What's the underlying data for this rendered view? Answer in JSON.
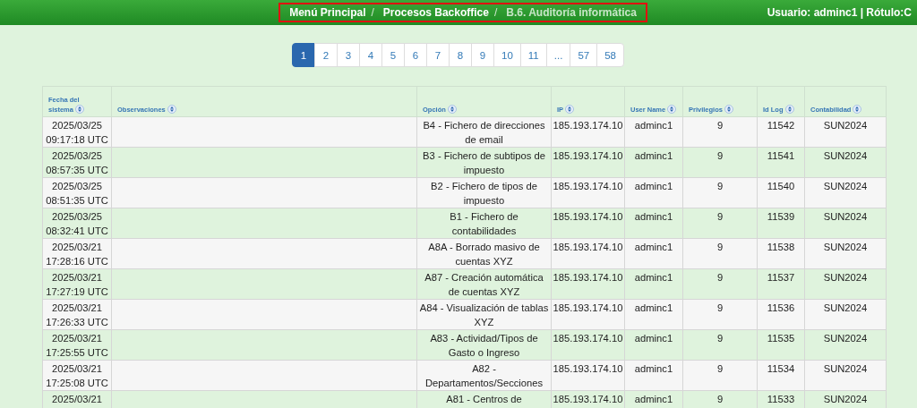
{
  "breadcrumb": [
    {
      "label": "Menú Principal",
      "current": false
    },
    {
      "label": "Procesos Backoffice",
      "current": false
    },
    {
      "label": "B.6. Auditoría informática",
      "current": true
    }
  ],
  "breadcrumb_separator": "/",
  "user_info": "Usuario: adminc1 | Rótulo:C",
  "pagination": [
    {
      "label": "1",
      "selected": true
    },
    {
      "label": "2",
      "selected": false
    },
    {
      "label": "3",
      "selected": false
    },
    {
      "label": "4",
      "selected": false
    },
    {
      "label": "5",
      "selected": false
    },
    {
      "label": "6",
      "selected": false
    },
    {
      "label": "7",
      "selected": false
    },
    {
      "label": "8",
      "selected": false
    },
    {
      "label": "9",
      "selected": false
    },
    {
      "label": "10",
      "selected": false
    },
    {
      "label": "11",
      "selected": false
    },
    {
      "label": "...",
      "selected": false
    },
    {
      "label": "57",
      "selected": false
    },
    {
      "label": "58",
      "selected": false
    }
  ],
  "table": {
    "columns": [
      {
        "label": "Fecha del sistema"
      },
      {
        "label": "Observaciones"
      },
      {
        "label": "Opción"
      },
      {
        "label": "IP"
      },
      {
        "label": "User Name"
      },
      {
        "label": "Privilegios"
      },
      {
        "label": "Id Log"
      },
      {
        "label": "Contabilidad"
      }
    ],
    "rows": [
      {
        "cells": [
          "2025/03/25 09:17:18 UTC",
          "",
          "B4 - Fichero de direcciones de email",
          "185.193.174.10",
          "adminc1",
          "9",
          "11542",
          "SUN2024"
        ]
      },
      {
        "cells": [
          "2025/03/25 08:57:35 UTC",
          "",
          "B3 - Fichero de subtipos de impuesto",
          "185.193.174.10",
          "adminc1",
          "9",
          "11541",
          "SUN2024"
        ]
      },
      {
        "cells": [
          "2025/03/25 08:51:35 UTC",
          "",
          "B2 - Fichero de tipos de impuesto",
          "185.193.174.10",
          "adminc1",
          "9",
          "11540",
          "SUN2024"
        ]
      },
      {
        "cells": [
          "2025/03/25 08:32:41 UTC",
          "",
          "B1 - Fichero de contabilidades",
          "185.193.174.10",
          "adminc1",
          "9",
          "11539",
          "SUN2024"
        ]
      },
      {
        "cells": [
          "2025/03/21 17:28:16 UTC",
          "",
          "A8A - Borrado masivo de cuentas XYZ",
          "185.193.174.10",
          "adminc1",
          "9",
          "11538",
          "SUN2024"
        ]
      },
      {
        "cells": [
          "2025/03/21 17:27:19 UTC",
          "",
          "A87 - Creación automática de cuentas XYZ",
          "185.193.174.10",
          "adminc1",
          "9",
          "11537",
          "SUN2024"
        ]
      },
      {
        "cells": [
          "2025/03/21 17:26:33 UTC",
          "",
          "A84 - Visualización de tablas XYZ",
          "185.193.174.10",
          "adminc1",
          "9",
          "11536",
          "SUN2024"
        ]
      },
      {
        "cells": [
          "2025/03/21 17:25:55 UTC",
          "",
          "A83 - Actividad/Tipos de Gasto o Ingreso",
          "185.193.174.10",
          "adminc1",
          "9",
          "11535",
          "SUN2024"
        ]
      },
      {
        "cells": [
          "2025/03/21 17:25:08 UTC",
          "",
          "A82 - Departamentos/Secciones",
          "185.193.174.10",
          "adminc1",
          "9",
          "11534",
          "SUN2024"
        ]
      },
      {
        "cells": [
          "2025/03/21",
          "",
          "A81 - Centros de",
          "185.193.174.10",
          "adminc1",
          "9",
          "11533",
          "SUN2024"
        ]
      }
    ]
  }
}
